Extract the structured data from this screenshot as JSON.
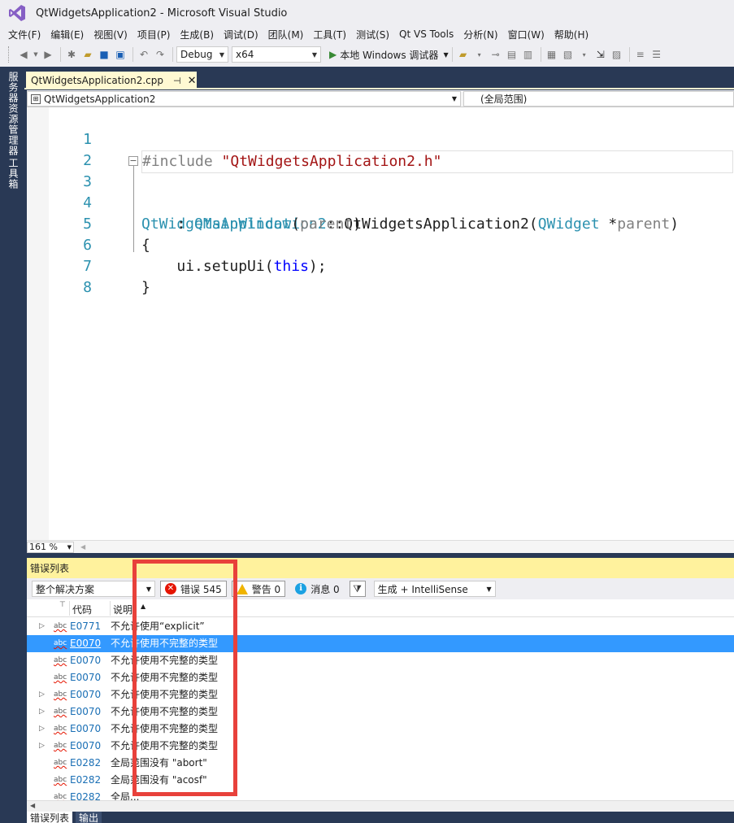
{
  "window": {
    "title": "QtWidgetsApplication2 - Microsoft Visual Studio"
  },
  "menu": [
    "文件(F)",
    "编辑(E)",
    "视图(V)",
    "项目(P)",
    "生成(B)",
    "调试(D)",
    "团队(M)",
    "工具(T)",
    "测试(S)",
    "Qt VS Tools",
    "分析(N)",
    "窗口(W)",
    "帮助(H)"
  ],
  "toolbar": {
    "config": "Debug",
    "platform": "x64",
    "run_label": "本地 Windows 调试器"
  },
  "side_tabs": {
    "server_explorer": "服务器资源管理器",
    "toolbox": "工具箱"
  },
  "document": {
    "tab_name": "QtWidgetsApplication2.cpp",
    "nav_class": "QtWidgetsApplication2",
    "nav_scope": "(全局范围)"
  },
  "editor": {
    "line_numbers": [
      "1",
      "2",
      "3",
      "4",
      "5",
      "6",
      "7",
      "8"
    ],
    "code": {
      "l1_pre": "#include ",
      "l1_str": "\"QtWidgetsApplication2.h\"",
      "l3_type": "QtWidgetsApplication2",
      "l3_sep": "::",
      "l3_func": "QtWidgetsApplication2",
      "l3_open": "(",
      "l3_ptype": "QWidget",
      "l3_star": " *",
      "l3_param": "parent",
      "l3_close": ")",
      "l4_colon": "    : ",
      "l4_type": "QMainWindow",
      "l4_open": "(",
      "l4_param": "parent",
      "l4_close": ")",
      "l5": "{",
      "l6_call": "    ui.setupUi(",
      "l6_kw": "this",
      "l6_end": ");",
      "l7": "}"
    },
    "zoom": "161 %"
  },
  "error_list": {
    "title": "错误列表",
    "scope": "整个解决方案",
    "errors_label": "错误 545",
    "warnings_label": "警告 0",
    "messages_label": "消息 0",
    "build_filter": "生成 + IntelliSense",
    "col_code": "代码",
    "col_desc": "说明",
    "rows": [
      {
        "code": "E0771",
        "desc": "不允许使用“explicit”"
      },
      {
        "code": "E0070",
        "desc": "不允许使用不完整的类型"
      },
      {
        "code": "E0070",
        "desc": "不允许使用不完整的类型"
      },
      {
        "code": "E0070",
        "desc": "不允许使用不完整的类型"
      },
      {
        "code": "E0070",
        "desc": "不允许使用不完整的类型"
      },
      {
        "code": "E0070",
        "desc": "不允许使用不完整的类型"
      },
      {
        "code": "E0070",
        "desc": "不允许使用不完整的类型"
      },
      {
        "code": "E0070",
        "desc": "不允许使用不完整的类型"
      },
      {
        "code": "E0282",
        "desc": "全局范围没有 \"abort\""
      },
      {
        "code": "E0282",
        "desc": "全局范围没有 \"acosf\""
      },
      {
        "code": "E0282",
        "desc": "全局..."
      }
    ]
  },
  "bottom_tabs": {
    "error_list": "错误列表",
    "output": "输出"
  },
  "colors": {
    "accent_highlight": "#e8413b",
    "selection": "#3399ff",
    "panel_title": "#fff29d",
    "doc_tab": "#fff9d2",
    "chrome_dark": "#293955"
  }
}
